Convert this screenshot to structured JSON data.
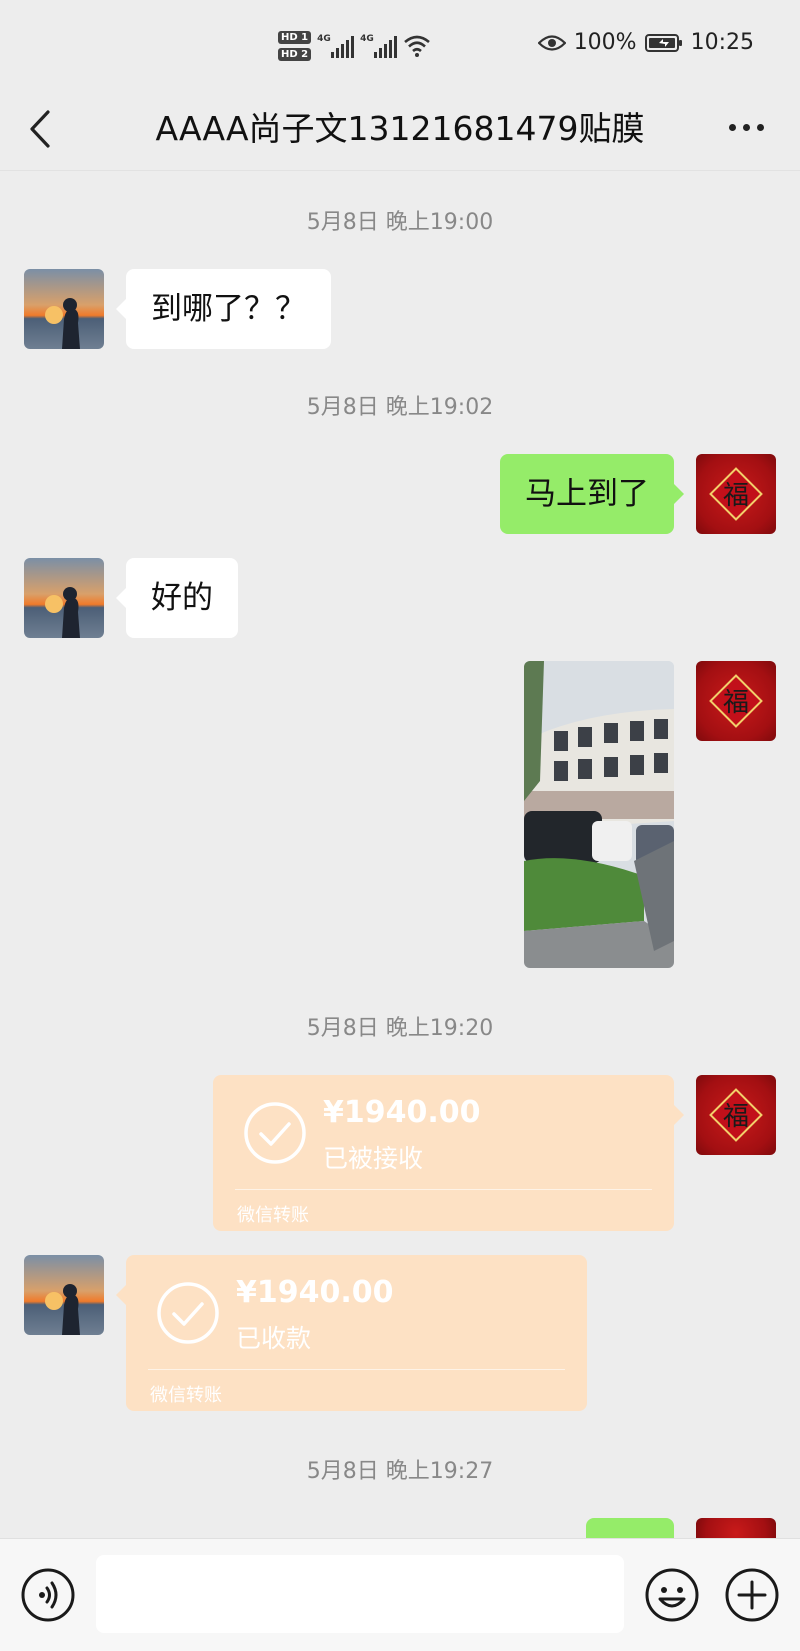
{
  "status_bar": {
    "hd1": "HD 1",
    "hd2": "HD 2",
    "net1": "4G",
    "net2": "4G",
    "battery": "100%",
    "time": "10:25",
    "icons": [
      "signal-icon",
      "wifi-icon",
      "eye-icon",
      "battery-icon"
    ]
  },
  "header": {
    "title": "AAAA尚子文13121681479贴膜"
  },
  "messages": [
    {
      "kind": "timestamp",
      "text": "5月8日 晚上19:00"
    },
    {
      "kind": "text",
      "side": "left",
      "text": "到哪了？？"
    },
    {
      "kind": "timestamp",
      "text": "5月8日 晚上19:02"
    },
    {
      "kind": "text",
      "side": "right",
      "text": "马上到了"
    },
    {
      "kind": "text",
      "side": "left",
      "text": "好的"
    },
    {
      "kind": "image",
      "side": "right"
    },
    {
      "kind": "timestamp",
      "text": "5月8日 晚上19:20"
    },
    {
      "kind": "transfer",
      "side": "right",
      "amount": "¥1940.00",
      "status": "已被接收",
      "footer": "微信转账"
    },
    {
      "kind": "transfer",
      "side": "left",
      "amount": "¥1940.00",
      "status": "已收款",
      "footer": "微信转账"
    },
    {
      "kind": "timestamp",
      "text": "5月8日 晚上19:27"
    }
  ],
  "input_bar": {
    "value": "",
    "icons": [
      "voice-icon",
      "emoji-icon",
      "plus-icon"
    ]
  },
  "colors": {
    "chat_bg": "#ededed",
    "outgoing_bubble": "#95ec69",
    "incoming_bubble": "#ffffff",
    "transfer_bubble": "#fde1c4",
    "timestamp_text": "#888888"
  }
}
